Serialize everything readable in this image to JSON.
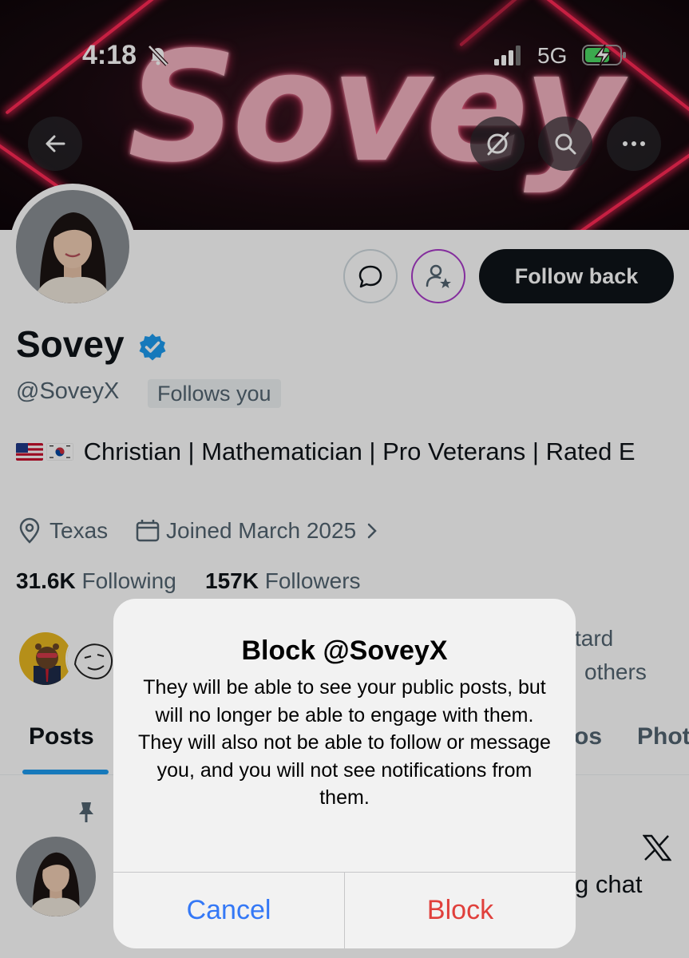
{
  "status_bar": {
    "time": "4:18",
    "network": "5G"
  },
  "banner": {
    "text": "Sovey"
  },
  "profile": {
    "name": "Sovey",
    "handle": "@SoveyX",
    "follows_you": "Follows you",
    "bio": "Christian | Mathematician | Pro Veterans | Rated E",
    "location": "Texas",
    "joined": "Joined March 2025",
    "following_count": "31.6K",
    "following_label": "Following",
    "followers_count": "157K",
    "followers_label": "Followers",
    "follow_button": "Follow back"
  },
  "followed_by": {
    "line1_fragment": "tard",
    "line2_fragment": "others"
  },
  "tabs": [
    "Posts",
    "os",
    "Phot"
  ],
  "post_preview": {
    "text_fragment": "g chat"
  },
  "dialog": {
    "title": "Block @SoveyX",
    "message": "They will be able to see your public posts, but will no longer be able to engage with them. They will also not be able to follow or message you, and you will not see notifications from them.",
    "cancel": "Cancel",
    "confirm": "Block"
  },
  "colors": {
    "accent": "#1d9bf0",
    "ios_blue": "#3478f6",
    "destructive": "#e0403c",
    "subscribe_ring": "#a93bc9"
  }
}
